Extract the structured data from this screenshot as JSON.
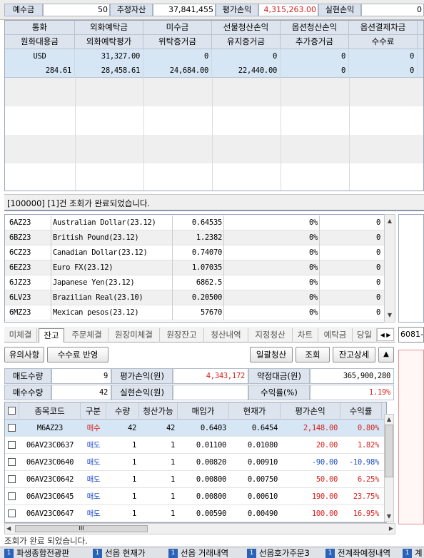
{
  "summary": {
    "deposit_label": "예수금",
    "deposit_value": "50",
    "est_asset_label": "추정자산",
    "est_asset_value": "37,841,455",
    "eval_pl_label": "평가손익",
    "eval_pl_value": "4,315,263.00",
    "realized_label": "실현손익",
    "realized_value": "0"
  },
  "account": {
    "headers_row1": [
      "통화",
      "외화예탁금",
      "미수금",
      "선물청산손익",
      "옵션청산손익",
      "옵션결제차금"
    ],
    "headers_row2": [
      "원화대용금",
      "외화예탁평가",
      "위탁증거금",
      "유지증거금",
      "추가증거금",
      "수수료"
    ],
    "row1": [
      "USD",
      "31,327.00",
      "0",
      "0",
      "0",
      "0"
    ],
    "row2": [
      "284.61",
      "28,458.61",
      "24,684.00",
      "22,440.00",
      "0",
      "0"
    ]
  },
  "status_message": "[100000] [1]건 조회가 완료되었습니다.",
  "futures": [
    {
      "code": "6AZ23",
      "name": "Australian Dollar(23.12)",
      "price": "0.64535",
      "pct": "0%",
      "qty": "0"
    },
    {
      "code": "6BZ23",
      "name": "British Pound(23.12)",
      "price": "1.2382",
      "pct": "0%",
      "qty": "0"
    },
    {
      "code": "6CZ23",
      "name": "Canadian Dollar(23.12)",
      "price": "0.74070",
      "pct": "0%",
      "qty": "0"
    },
    {
      "code": "6EZ23",
      "name": "Euro FX(23.12)",
      "price": "1.07035",
      "pct": "0%",
      "qty": "0"
    },
    {
      "code": "6JZ23",
      "name": "Japanese Yen(23.12)",
      "price": "6862.5",
      "pct": "0%",
      "qty": "0"
    },
    {
      "code": "6LV23",
      "name": "Brazilian Real(23.10)",
      "price": "0.20500",
      "pct": "0%",
      "qty": "0"
    },
    {
      "code": "6MZ23",
      "name": "Mexican pesos(23.12)",
      "price": "57670",
      "pct": "0%",
      "qty": "0"
    }
  ],
  "tabs": [
    "미체결",
    "잔고",
    "주문체결",
    "원장미체결",
    "원장잔고",
    "청산내역",
    "지정청산",
    "차트",
    "예탁금",
    "당일"
  ],
  "right_input": "6081-",
  "toolbar": {
    "notice": "유의사항",
    "fee_reflect": "수수료 반영",
    "bulk_liquidate": "일괄청산",
    "inquire": "조회",
    "balance_detail": "잔고상세"
  },
  "info": {
    "sell_qty_label": "매도수량",
    "sell_qty": "9",
    "eval_pl_won_label": "평가손익(원)",
    "eval_pl_won": "4,343,172",
    "contract_amt_label": "약정대금(원)",
    "contract_amt": "365,900,280",
    "buy_qty_label": "매수수량",
    "buy_qty": "42",
    "realized_won_label": "실현손익(원)",
    "realized_won": "",
    "return_label": "수익률(%)",
    "return_value": "1.19%"
  },
  "positions": {
    "headers": [
      "종목코드",
      "구분",
      "수량",
      "청산가능",
      "매입가",
      "현재가",
      "평가손익",
      "수익률"
    ],
    "rows": [
      {
        "code": "M6AZ23",
        "side": "매수",
        "qty": "42",
        "avail": "42",
        "buy": "0.6403",
        "cur": "0.6454",
        "pl": "2,148.00",
        "rate": "0.80%"
      },
      {
        "code": "06AV23C0637",
        "side": "매도",
        "qty": "1",
        "avail": "1",
        "buy": "0.01100",
        "cur": "0.01080",
        "pl": "20.00",
        "rate": "1.82%"
      },
      {
        "code": "06AV23C0640",
        "side": "매도",
        "qty": "1",
        "avail": "1",
        "buy": "0.00820",
        "cur": "0.00910",
        "pl": "-90.00",
        "rate": "-10.98%"
      },
      {
        "code": "06AV23C0642",
        "side": "매도",
        "qty": "1",
        "avail": "1",
        "buy": "0.00800",
        "cur": "0.00750",
        "pl": "50.00",
        "rate": "6.25%"
      },
      {
        "code": "06AV23C0645",
        "side": "매도",
        "qty": "1",
        "avail": "1",
        "buy": "0.00800",
        "cur": "0.00610",
        "pl": "190.00",
        "rate": "23.75%"
      },
      {
        "code": "06AV23C0647",
        "side": "매도",
        "qty": "1",
        "avail": "1",
        "buy": "0.00590",
        "cur": "0.00490",
        "pl": "100.00",
        "rate": "16.95%"
      }
    ]
  },
  "hscroll_grip": "III",
  "status_bottom": "조회가 완료 되었습니다.",
  "taskbar": [
    {
      "num": "1",
      "label": "파생종합전광판"
    },
    {
      "num": "1",
      "label": "선옵 현재가"
    },
    {
      "num": "1",
      "label": "선옵 거래내역"
    },
    {
      "num": "1",
      "label": "선옵호가주문3"
    },
    {
      "num": "1",
      "label": "전계좌예정내역"
    },
    {
      "num": "1",
      "label": "계"
    }
  ],
  "colors": {
    "profit": "#d8231e",
    "loss": "#1d4cc7",
    "sell": "#1d4cc7",
    "buy": "#d8231e",
    "header_bg": "#dde4ee",
    "selected_row": "#d6e6f5"
  }
}
